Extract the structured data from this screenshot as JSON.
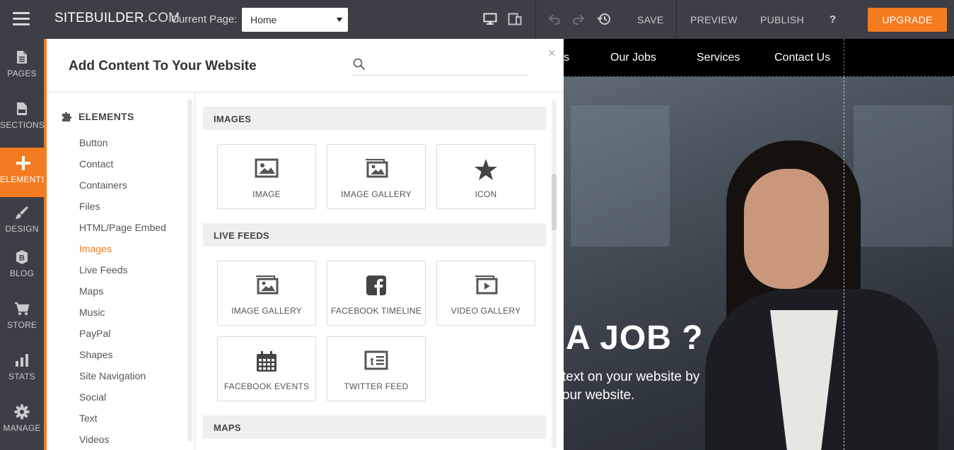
{
  "topbar": {
    "logo": "SITEBUILDER",
    "logo_suffix": ".COM",
    "current_page_label": "Current Page:",
    "current_page_value": "Home",
    "save": "SAVE",
    "preview": "PREVIEW",
    "publish": "PUBLISH",
    "help": "?",
    "upgrade": "UPGRADE"
  },
  "sidebar": {
    "items": [
      {
        "label": "PAGES",
        "icon": "pages-icon"
      },
      {
        "label": "SECTIONS",
        "icon": "sections-icon"
      },
      {
        "label": "ELEMENTS",
        "icon": "plus-icon"
      },
      {
        "label": "DESIGN",
        "icon": "brush-icon"
      },
      {
        "label": "BLOG",
        "icon": "blog-icon"
      },
      {
        "label": "STORE",
        "icon": "cart-icon"
      },
      {
        "label": "STATS",
        "icon": "stats-icon"
      },
      {
        "label": "MANAGE",
        "icon": "gear-icon"
      }
    ],
    "active_index": 2
  },
  "panel": {
    "title": "Add Content To Your Website",
    "search_placeholder": "",
    "close": "×",
    "elements_header": "ELEMENTS",
    "categories": [
      "Button",
      "Contact",
      "Containers",
      "Files",
      "HTML/Page Embed",
      "Images",
      "Live Feeds",
      "Maps",
      "Music",
      "PayPal",
      "Shapes",
      "Site Navigation",
      "Social",
      "Text",
      "Videos"
    ],
    "active_category": "Images",
    "sections": {
      "images": {
        "title": "IMAGES",
        "tiles": [
          "IMAGE",
          "IMAGE GALLERY",
          "ICON"
        ]
      },
      "live_feeds": {
        "title": "LIVE FEEDS",
        "tiles": [
          "IMAGE GALLERY",
          "FACEBOOK TIMELINE",
          "VIDEO GALLERY",
          "FACEBOOK EVENTS",
          "TWITTER FEED"
        ]
      },
      "maps": {
        "title": "MAPS"
      }
    }
  },
  "preview": {
    "nav": [
      "s",
      "Our Jobs",
      "Services",
      "Contact Us"
    ],
    "hero_title": "A JOB ?",
    "hero_sub_1": "text on your website by",
    "hero_sub_2": "our website."
  },
  "colors": {
    "accent": "#f47b20",
    "topbar_bg": "#3d3e46",
    "panel_bg": "#ffffff"
  }
}
